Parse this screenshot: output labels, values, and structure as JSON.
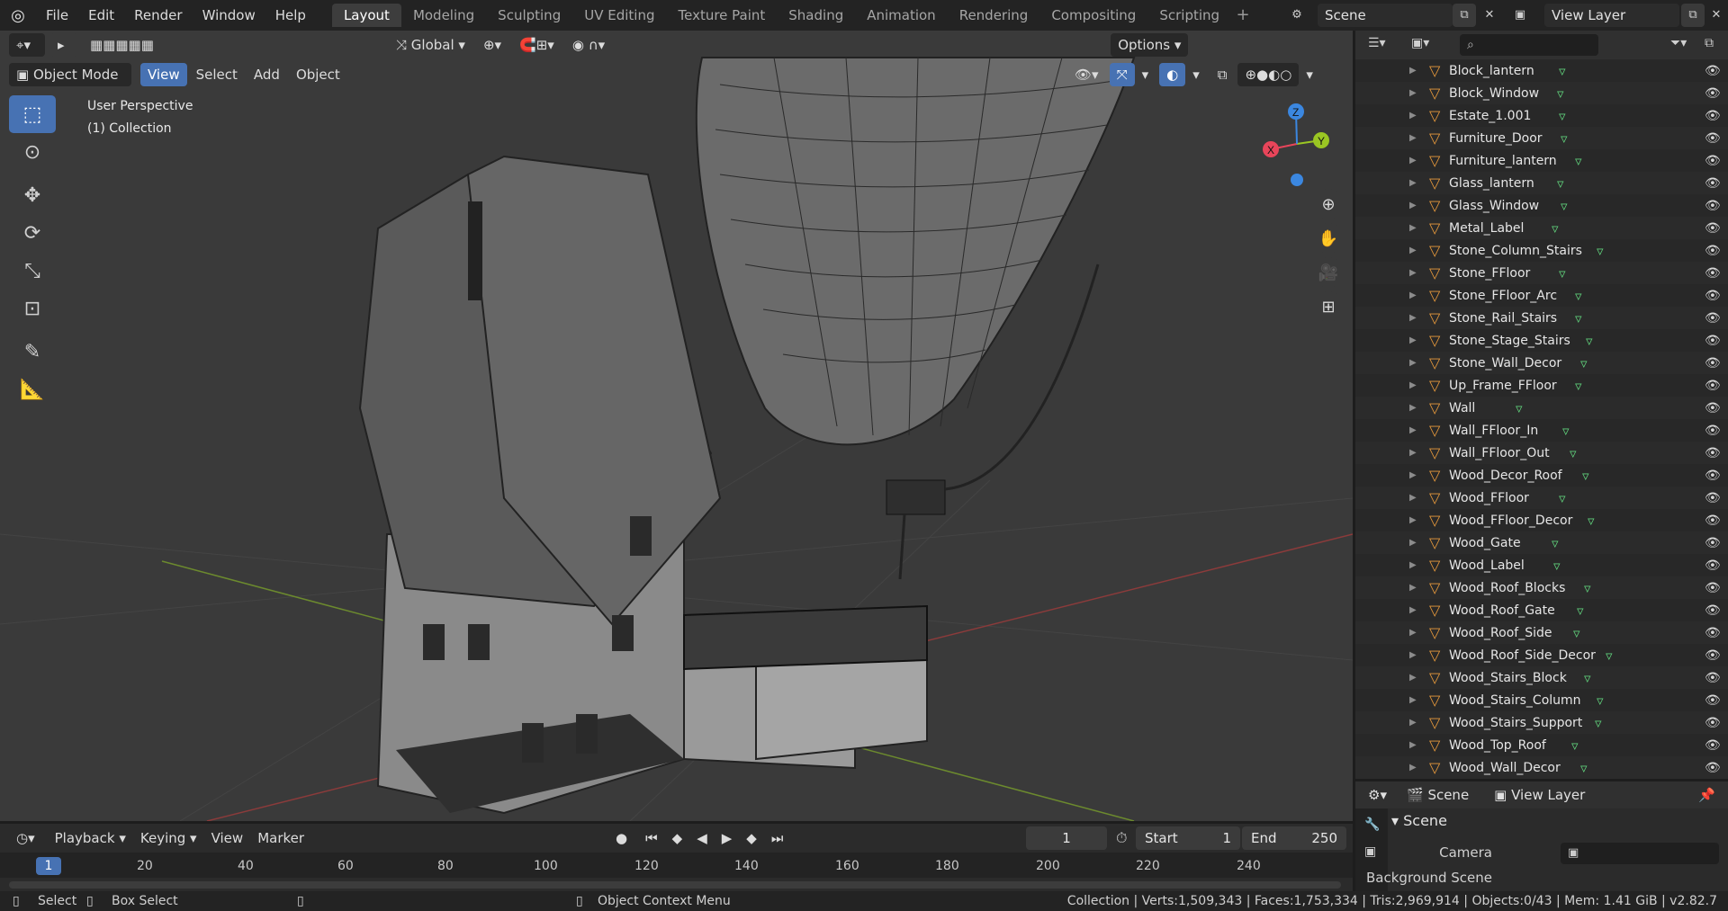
{
  "topbar": {
    "menus": [
      "File",
      "Edit",
      "Render",
      "Window",
      "Help"
    ],
    "workspaces": [
      "Layout",
      "Modeling",
      "Sculpting",
      "UV Editing",
      "Texture Paint",
      "Shading",
      "Animation",
      "Rendering",
      "Compositing",
      "Scripting"
    ],
    "active_workspace": "Layout",
    "add_workspace": "+",
    "scene_name": "Scene",
    "view_layer_name": "View Layer"
  },
  "viewport": {
    "mode": "Object Mode",
    "menus": [
      "View",
      "Select",
      "Add",
      "Object"
    ],
    "transform_orientation": "Global",
    "options_label": "Options",
    "perspective_label": "User Perspective",
    "collection_label": "(1) Collection",
    "gizmo": {
      "x": "X",
      "y": "Y",
      "z": "Z"
    }
  },
  "outliner": {
    "search_placeholder": "",
    "items": [
      "Block_lantern",
      "Block_Window",
      "Estate_1.001",
      "Furniture_Door",
      "Furniture_lantern",
      "Glass_lantern",
      "Glass_Window",
      "Metal_Label",
      "Stone_Column_Stairs",
      "Stone_FFloor",
      "Stone_FFloor_Arc",
      "Stone_Rail_Stairs",
      "Stone_Stage_Stairs",
      "Stone_Wall_Decor",
      "Up_Frame_FFloor",
      "Wall",
      "Wall_FFloor_In",
      "Wall_FFloor_Out",
      "Wood_Decor_Roof",
      "Wood_FFloor",
      "Wood_FFloor_Decor",
      "Wood_Gate",
      "Wood_Label",
      "Wood_Roof_Blocks",
      "Wood_Roof_Gate",
      "Wood_Roof_Side",
      "Wood_Roof_Side_Decor",
      "Wood_Stairs_Block",
      "Wood_Stairs_Column",
      "Wood_Stairs_Support",
      "Wood_Top_Roof",
      "Wood_Wall_Decor"
    ]
  },
  "properties": {
    "scene_tab": "Scene",
    "view_layer_tab": "View Layer",
    "panel_title": "Scene",
    "camera_label": "Camera",
    "background_label": "Background Scene"
  },
  "timeline": {
    "menus": [
      "Playback",
      "Keying",
      "View",
      "Marker"
    ],
    "current_frame": "1",
    "start_label": "Start",
    "start_value": "1",
    "end_label": "End",
    "end_value": "250",
    "ruler": [
      "1",
      "20",
      "40",
      "60",
      "80",
      "100",
      "120",
      "140",
      "160",
      "180",
      "200",
      "220",
      "240"
    ]
  },
  "statusbar": {
    "select": "Select",
    "box_select": "Box Select",
    "context_menu": "Object Context Menu",
    "stats": "Collection | Verts:1,509,343 | Faces:1,753,334 | Tris:2,969,914 | Objects:0/43 | Mem: 1.41 GiB | v2.82.7"
  },
  "colors": {
    "accent": "#4772b3",
    "object_icon": "#e89a3c",
    "mesh_icon": "#5fce7a",
    "axis_x": "#e8455a",
    "axis_y": "#9ac623",
    "axis_z": "#3b87e0"
  }
}
